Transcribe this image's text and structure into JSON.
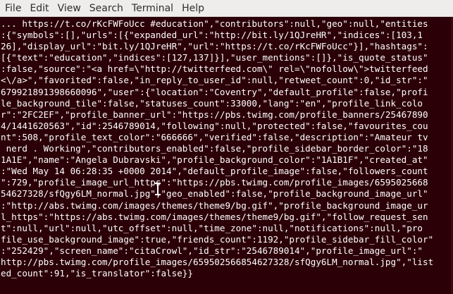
{
  "menubar": {
    "items": [
      "File",
      "Edit",
      "View",
      "Search",
      "Terminal",
      "Help"
    ]
  },
  "terminal": {
    "colors": {
      "background": "#2b0006",
      "foreground": "#ffffff",
      "menubar": "#eeedeb"
    },
    "lines": [
      "... https://t.co/rKcFWFoUcc #education\",\"contributors\":null,\"geo\":null,\"entities",
      ":{\"symbols\":[],\"urls\":[{\"expanded_url\":\"http://bit.ly/1QJreHR\",\"indices\":[103,1",
      "26],\"display_url\":\"bit.ly/1QJreHR\",\"url\":\"https://t.co/rKcFWFoUcc\"}],\"hashtags\":",
      "[{\"text\":\"education\",\"indices\":[127,137]}],\"user_mentions\":[]},\"is_quote_status\"",
      ":false,\"source\":\"<a href=\\\"http://twitterfeed.com\\\" rel=\\\"nofollow\\\">twitterfeed",
      "<\\/a>\",\"favorited\":false,\"in_reply_to_user_id\":null,\"retweet_count\":0,\"id_str\":\"",
      "679921891398660096\",\"user\":{\"location\":\"Coventry\",\"default_profile\":false,\"profi",
      "le_background_tile\":false,\"statuses_count\":33000,\"lang\":\"en\",\"profile_link_colo",
      "r\":\"2FC2EF\",\"profile_banner_url\":\"https://pbs.twimg.com/profile_banners/25467890",
      "4/1441620563\",\"id\":2546789014,\"following\":null,\"protected\":false,\"favourites_cou",
      "nt\":508,\"profile_text_color\":\"666666\",\"verified\":false,\"description\":\"Amateur tv",
      " nerd . Working\",\"contributors_enabled\":false,\"profile_sidebar_border_color\":\"18",
      "1A1E\",\"name\":\"Angela Dubravski\",\"profile_background_color\":\"1A1B1F\",\"created_at\"",
      ":\"Wed May 14 06:28:35 +0000 2014\",\"default_profile_image\":false,\"followers_count",
      "\":729,\"profile_image_url_https\":\"https://pbs.twimg.com/profile_images/6595025668",
      "54627328/sfQgy6LM_normal.jpg\",\"geo_enabled\":false,\"profile_background_image_url\"",
      ":\"http://abs.twimg.com/images/themes/theme9/bg.gif\",\"profile_background_image_ur",
      "l_https\":\"https://abs.twimg.com/images/themes/theme9/bg.gif\",\"follow_request_sen",
      "t\":null,\"url\":null,\"utc_offset\":null,\"time_zone\":null,\"notifications\":null,\"pro",
      "file_use_background_image\":true,\"friends_count\":1192,\"profile_sidebar_fill_color\"",
      ":\"252429\",\"screen_name\":\"citaCrowl\",\"id_str\":\"2546789014\",\"profile_image_url\":\"",
      "http://pbs.twimg.com/profile_images/659502566854627328/sfQgy6LM_normal.jpg\",\"list",
      "ed_count\":91,\"is_translator\":false}}"
    ]
  }
}
